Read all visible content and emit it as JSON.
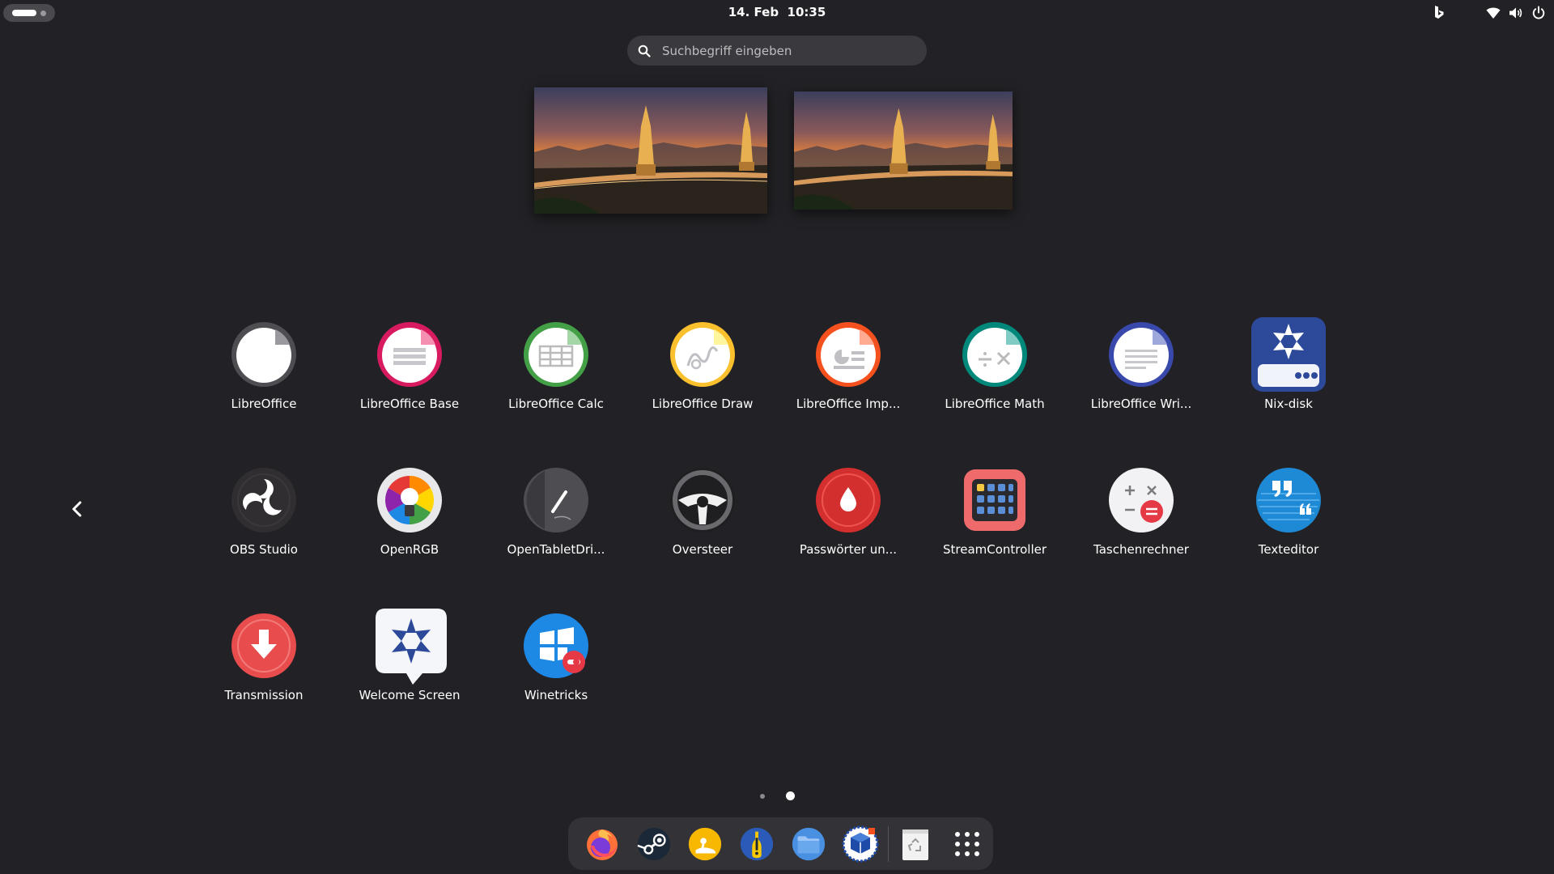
{
  "topbar": {
    "date": "14. Feb",
    "time": "10:35",
    "tray_icons": [
      "bing-icon",
      "wifi-icon",
      "volume-icon",
      "power-icon"
    ]
  },
  "search": {
    "placeholder": "Suchbegriff eingeben",
    "value": ""
  },
  "workspaces": [
    "workspace-1",
    "workspace-2"
  ],
  "apps": [
    {
      "label": "LibreOffice",
      "icon": "libreoffice-icon",
      "accent": "#5e5e62"
    },
    {
      "label": "LibreOffice Base",
      "icon": "libreoffice-base-icon",
      "accent": "#d81b60"
    },
    {
      "label": "LibreOffice Calc",
      "icon": "libreoffice-calc-icon",
      "accent": "#43a047"
    },
    {
      "label": "LibreOffice Draw",
      "icon": "libreoffice-draw-icon",
      "accent": "#fbc02d"
    },
    {
      "label": "LibreOffice Imp...",
      "icon": "libreoffice-impress-icon",
      "accent": "#f4511e"
    },
    {
      "label": "LibreOffice Math",
      "icon": "libreoffice-math-icon",
      "accent": "#00897b"
    },
    {
      "label": "LibreOffice Wri...",
      "icon": "libreoffice-writer-icon",
      "accent": "#3949ab"
    },
    {
      "label": "Nix-disk",
      "icon": "nix-disk-icon",
      "accent": "#2a4a9a"
    },
    {
      "label": "OBS Studio",
      "icon": "obs-studio-icon",
      "accent": "#302e31"
    },
    {
      "label": "OpenRGB",
      "icon": "openrgb-icon",
      "accent": "#f0f0f0"
    },
    {
      "label": "OpenTabletDri...",
      "icon": "opentabletdriver-icon",
      "accent": "#4a4a4e"
    },
    {
      "label": "Oversteer",
      "icon": "oversteer-icon",
      "accent": "#1a1a1a"
    },
    {
      "label": "Passwörter un...",
      "icon": "passwords-icon",
      "accent": "#d32f2f"
    },
    {
      "label": "StreamController",
      "icon": "streamcontroller-icon",
      "accent": "#ef6a6a"
    },
    {
      "label": "Taschenrechner",
      "icon": "calculator-icon",
      "accent": "#e53946"
    },
    {
      "label": "Texteditor",
      "icon": "text-editor-icon",
      "accent": "#1e8ad6"
    },
    {
      "label": "Transmission",
      "icon": "transmission-icon",
      "accent": "#e84c4c"
    },
    {
      "label": "Welcome Screen",
      "icon": "welcome-screen-icon",
      "accent": "#2a4a9a"
    },
    {
      "label": "Winetricks",
      "icon": "winetricks-icon",
      "accent": "#1e88e5"
    }
  ],
  "pager": {
    "pages": 2,
    "active": 2
  },
  "dock": [
    {
      "icon": "firefox-icon"
    },
    {
      "icon": "steam-icon"
    },
    {
      "icon": "lutris-icon"
    },
    {
      "icon": "bottles-icon"
    },
    {
      "icon": "files-icon"
    },
    {
      "icon": "virtualbox-icon"
    },
    {
      "icon": "trash-icon"
    },
    {
      "icon": "show-apps-icon"
    }
  ]
}
